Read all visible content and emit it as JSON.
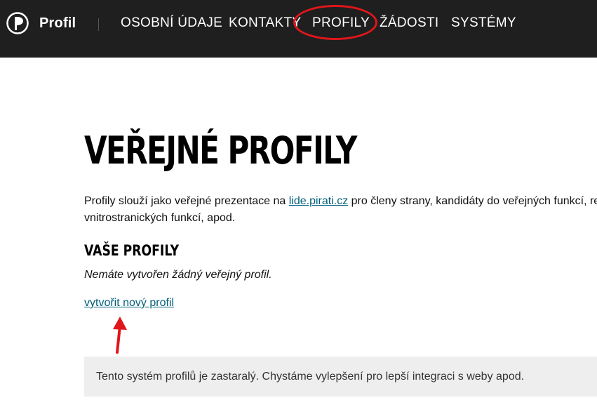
{
  "header": {
    "brand": "Profil",
    "nav": [
      "OSOBNÍ ÚDAJE",
      "KONTAKTY",
      "PROFILY",
      "ŽÁDOSTI",
      "SYSTÉMY"
    ]
  },
  "page": {
    "title": "VEŘEJNÉ PROFILY",
    "intro_before": "Profily slouží jako veřejné prezentace na ",
    "intro_link": "lide.pirati.cz",
    "intro_after": " pro členy strany, kandidáty do veřejných funkcí, reg",
    "intro_line2": "vnitrostranických funkcí, apod.",
    "subtitle": "VAŠE PROFILY",
    "empty_message": "Nemáte vytvořen žádný veřejný profil.",
    "new_profile_link": "vytvořit nový profil",
    "notice": "Tento systém profilů je zastaralý. Chystáme vylepšení pro lepší integraci s weby apod."
  },
  "colors": {
    "header_bg": "#1f1f1f",
    "link": "#005e7a",
    "annotation": "#e0161b",
    "notice_bg": "#eeeeee"
  }
}
